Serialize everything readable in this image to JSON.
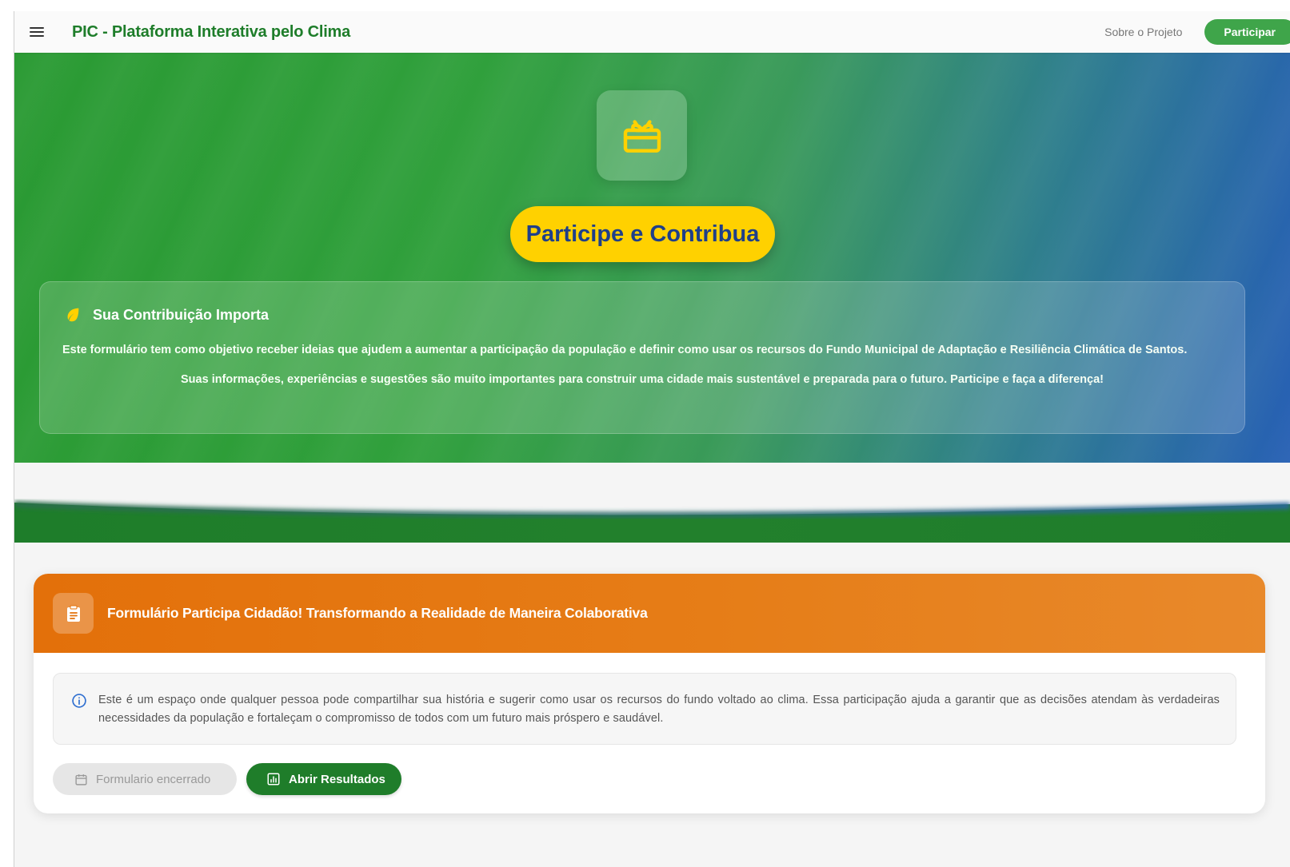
{
  "header": {
    "menu_icon": "hamburger-menu-icon",
    "title": "PIC - Plataforma Interativa pelo Clima",
    "nav_link": "Sobre o Projeto",
    "cta_label": "Participar"
  },
  "hero": {
    "icon": "gift-box-icon",
    "headline": "Participe e Contribua",
    "card": {
      "icon": "leaf-icon",
      "title": "Sua Contribuição Importa",
      "paragraph1": "Este formulário tem como objetivo receber ideias que ajudem a aumentar a participação da população e definir como usar os recursos do Fundo Municipal de Adaptação e Resiliência Climática de Santos.",
      "paragraph2": "Suas informações, experiências e sugestões são muito importantes para construir uma cidade mais sustentável e preparada para o futuro. Participe e faça a diferença!"
    }
  },
  "form_card": {
    "icon": "clipboard-icon",
    "title": "Formulário Participa Cidadão! Transformando a Realidade de Maneira Colaborativa",
    "notice_icon": "info-icon",
    "notice": "Este é um espaço onde qualquer pessoa pode compartilhar sua história e sugerir como usar os recursos do fundo voltado ao clima. Essa participação ajuda a garantir que as decisões atendam às verdadeiras necessidades da população e fortaleçam o compromisso de todos com um futuro mais próspero e saudável.",
    "closed_button": {
      "icon": "calendar-icon",
      "label": "Formulario encerrado"
    },
    "results_button": {
      "icon": "chart-icon",
      "label": "Abrir Resultados"
    }
  },
  "colors": {
    "brand_green": "#1e7d2a",
    "accent_yellow": "#ffd100",
    "headline_blue": "#1f3f8a",
    "form_orange": "#e3700a"
  }
}
